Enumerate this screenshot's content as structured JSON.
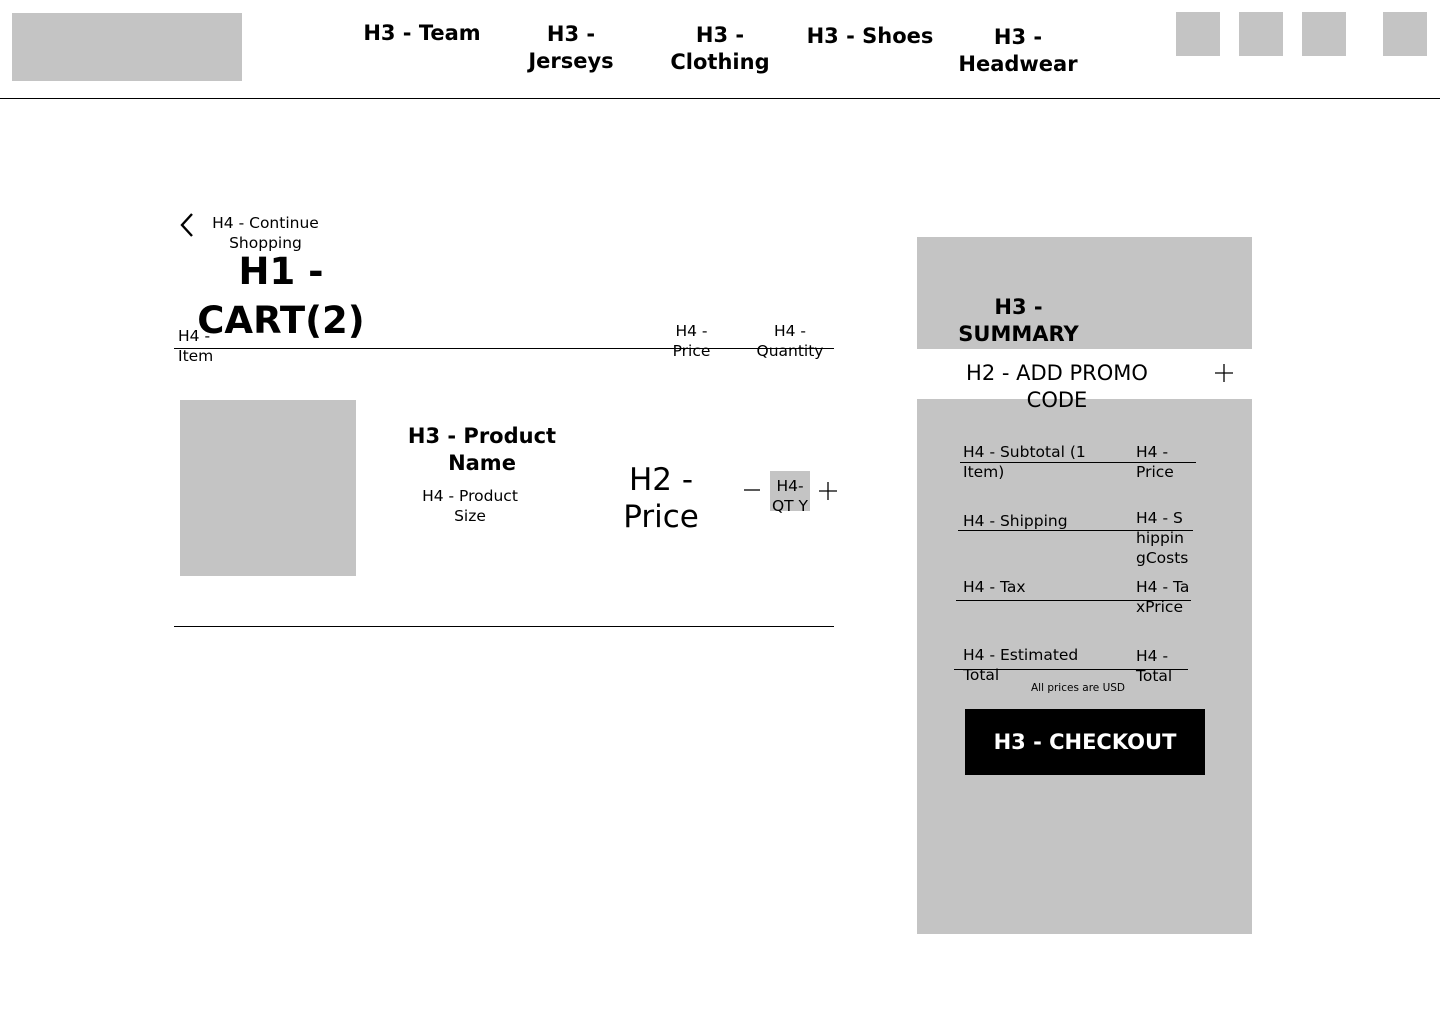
{
  "nav": {
    "team": "H3 - Team",
    "jerseys": "H3 - Jerseys",
    "clothing": "H3 - Clothing",
    "shoes": "H3 - Shoes",
    "headwear": "H3 - Headwear"
  },
  "cart": {
    "continue": "H4 - Continue Shopping",
    "title": "H1 - CART(2)",
    "col_item": "H4 - Item",
    "col_price": "H4 - Price",
    "col_qty": "H4 - Quantity",
    "product_name": "H3 - Product Name",
    "product_size": "H4 - Product Size",
    "price": "H2 - Price",
    "qty": "H4- QT Y"
  },
  "summary": {
    "title": "H3 - SUMMARY",
    "promo": "H2 - ADD PROMO CODE",
    "subtotal_label": "H4 - Subtotal (1 Item)",
    "subtotal_value": "H4 - Price",
    "shipping_label": "H4 - Shipping",
    "shipping_value": "H4 - ShippingCosts",
    "tax_label": "H4 - Tax",
    "tax_value": "H4 - TaxPrice",
    "total_label": "H4 - Estimated Total",
    "total_value": "H4 - Total",
    "note": "All prices are USD",
    "checkout": "H3 - CHECKOUT"
  },
  "colors": {
    "placeholder": "#c4c4c4",
    "checkout_bg": "#000000"
  }
}
